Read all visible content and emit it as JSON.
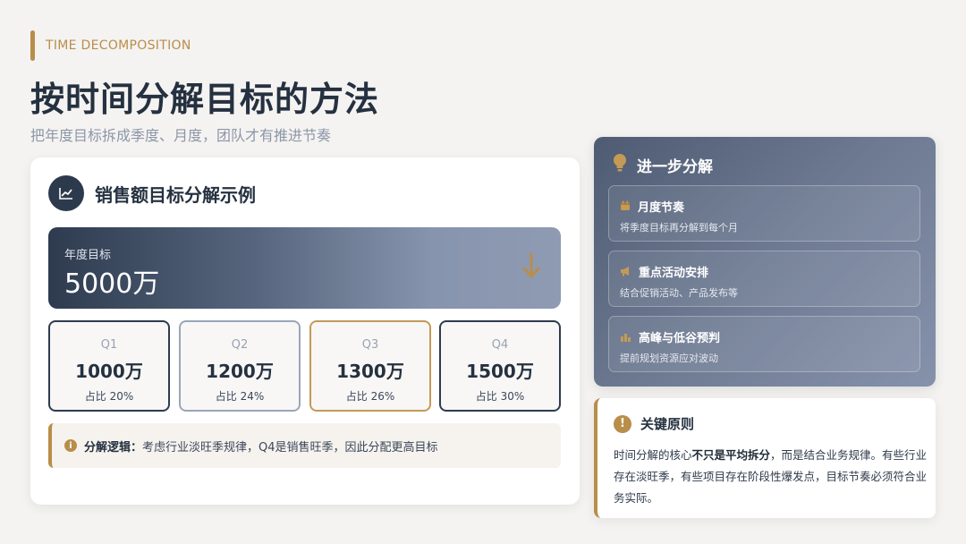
{
  "header": {
    "tag": "TIME DECOMPOSITION",
    "title": "按时间分解目标的方法",
    "subtitle": "把年度目标拆成季度、月度，团队才有推进节奏"
  },
  "left_card": {
    "icon": "line-chart-icon",
    "title": "销售额目标分解示例",
    "annual": {
      "label": "年度目标",
      "value": "5000万",
      "icon": "arrow-down-icon"
    },
    "quarters": [
      {
        "name": "Q1",
        "value": "1000万",
        "share": "占比 20%",
        "border_color": "#2e3b4f"
      },
      {
        "name": "Q2",
        "value": "1200万",
        "share": "占比 24%",
        "border_color": "#9aa6b8"
      },
      {
        "name": "Q3",
        "value": "1300万",
        "share": "占比 26%",
        "border_color": "#c49a56"
      },
      {
        "name": "Q4",
        "value": "1500万",
        "share": "占比 30%",
        "border_color": "#2e3b4f"
      }
    ],
    "logic": {
      "icon": "info-icon",
      "label": "分解逻辑：",
      "text": "考虑行业淡旺季规律，Q4是销售旺季，因此分配更高目标"
    }
  },
  "right_card": {
    "icon": "lightbulb-icon",
    "title": "进一步分解",
    "items": [
      {
        "icon": "calendar-icon",
        "title": "月度节奏",
        "desc": "将季度目标再分解到每个月"
      },
      {
        "icon": "megaphone-icon",
        "title": "重点活动安排",
        "desc": "结合促销活动、产品发布等"
      },
      {
        "icon": "bar-chart-icon",
        "title": "高峰与低谷预判",
        "desc": "提前规划资源应对波动"
      }
    ]
  },
  "principle": {
    "icon": "exclamation-icon",
    "title": "关键原则",
    "body_pre": "时间分解的核心",
    "body_bold": "不只是平均拆分",
    "body_post": "，而是结合业务规律。有些行业存在淡旺季，有些项目存在阶段性爆发点，目标节奏必须符合业务实际。"
  },
  "colors": {
    "accent": "#b98d4a",
    "dark": "#253140"
  }
}
